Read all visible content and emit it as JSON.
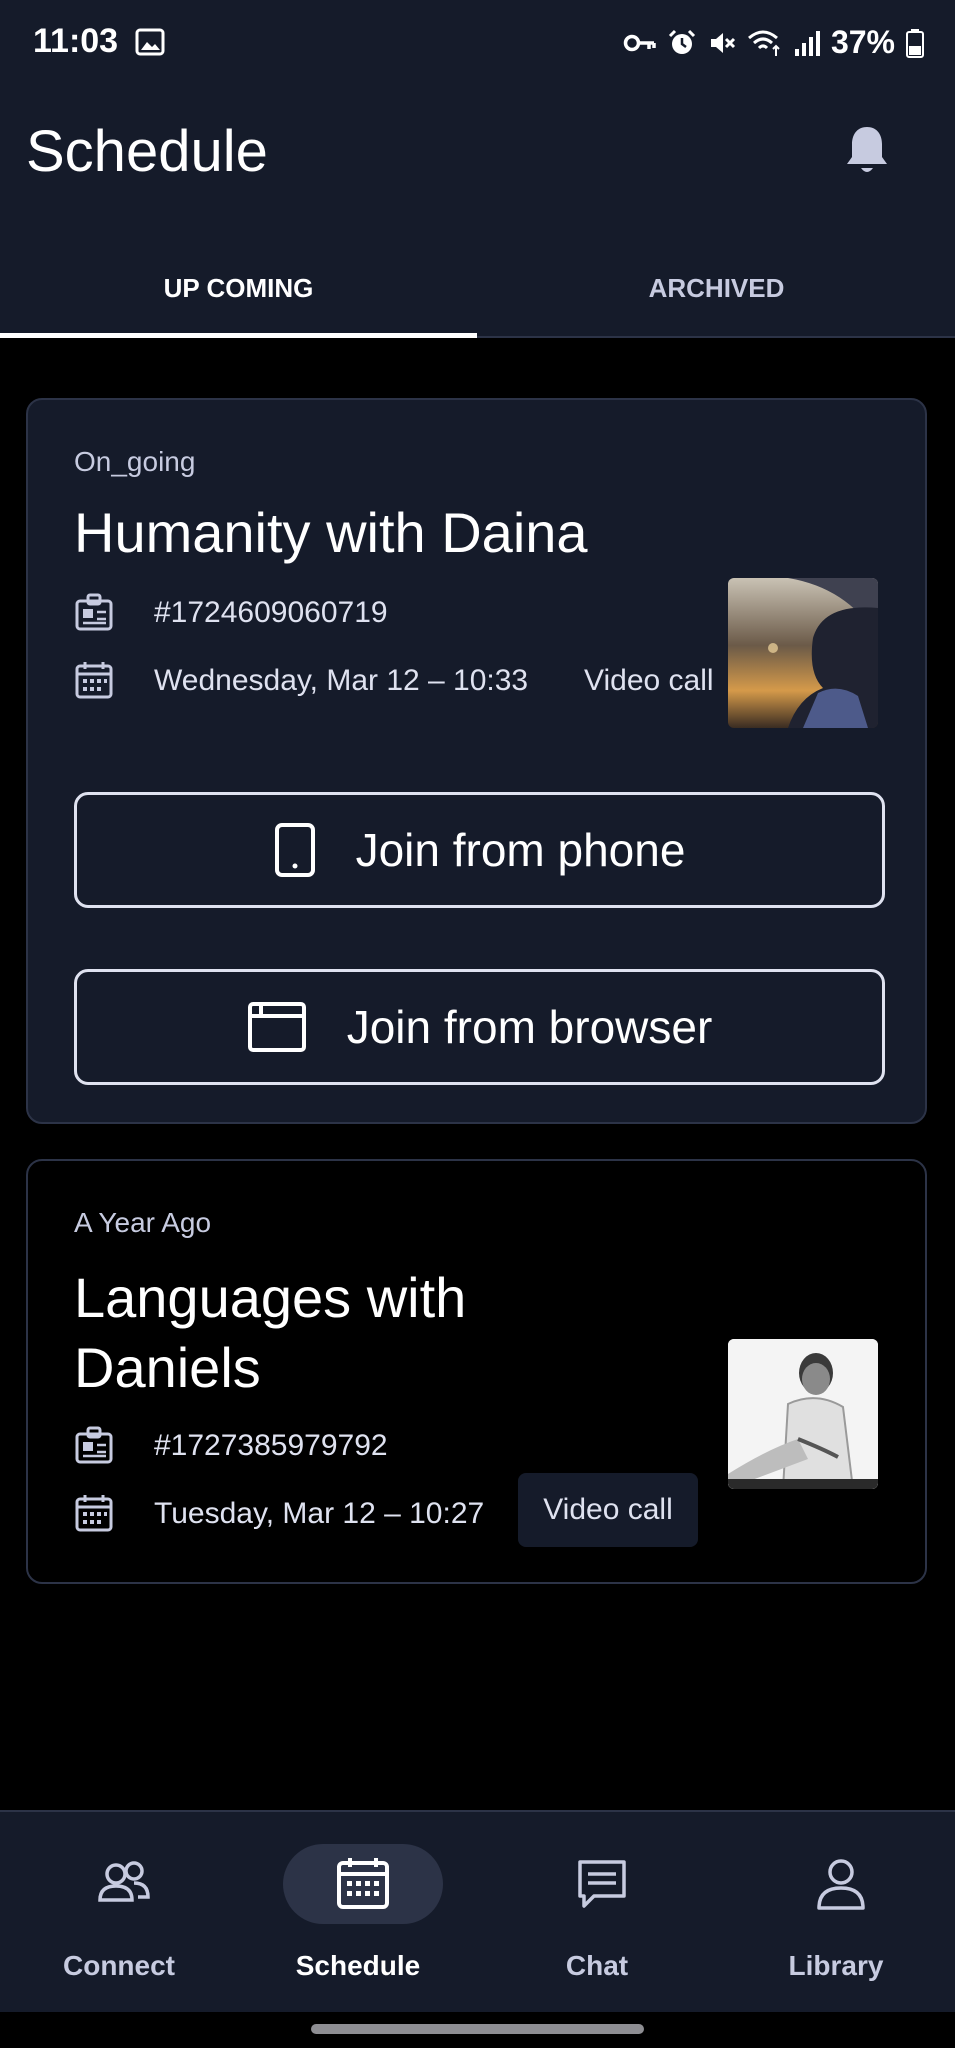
{
  "status_bar": {
    "time": "11:03",
    "battery": "37%",
    "icons": [
      "gallery-icon",
      "vpn-key-icon",
      "alarm-icon",
      "mute-icon",
      "wifi-icon",
      "signal-icon",
      "battery-icon"
    ]
  },
  "header": {
    "title": "Schedule",
    "notification_icon": "bell-icon"
  },
  "tabs": [
    {
      "label": "UP COMING",
      "active": true
    },
    {
      "label": "ARCHIVED",
      "active": false
    }
  ],
  "meetings": [
    {
      "status": "On_going",
      "title": "Humanity with Daina",
      "id": "#1724609060719",
      "datetime": "Wednesday, Mar 12 – 10:33",
      "call_type": "Video call",
      "actions": [
        {
          "label": "Join from phone",
          "icon": "phone-icon"
        },
        {
          "label": "Join from browser",
          "icon": "browser-icon"
        }
      ]
    },
    {
      "status": "A Year Ago",
      "title_line1": "Languages with",
      "title_line2": "Daniels",
      "id": "#1727385979792",
      "datetime": "Tuesday, Mar 12 – 10:27",
      "call_type": "Video call"
    }
  ],
  "bottom_nav": [
    {
      "label": "Connect",
      "icon": "people-icon",
      "active": false
    },
    {
      "label": "Schedule",
      "icon": "calendar-icon",
      "active": true
    },
    {
      "label": "Chat",
      "icon": "chat-icon",
      "active": false
    },
    {
      "label": "Library",
      "icon": "person-icon",
      "active": false
    }
  ],
  "colors": {
    "surface": "#151b2a",
    "background": "#000000",
    "outline": "#2c3347",
    "text_primary": "#ffffff",
    "text_secondary": "#c7cbe0"
  }
}
